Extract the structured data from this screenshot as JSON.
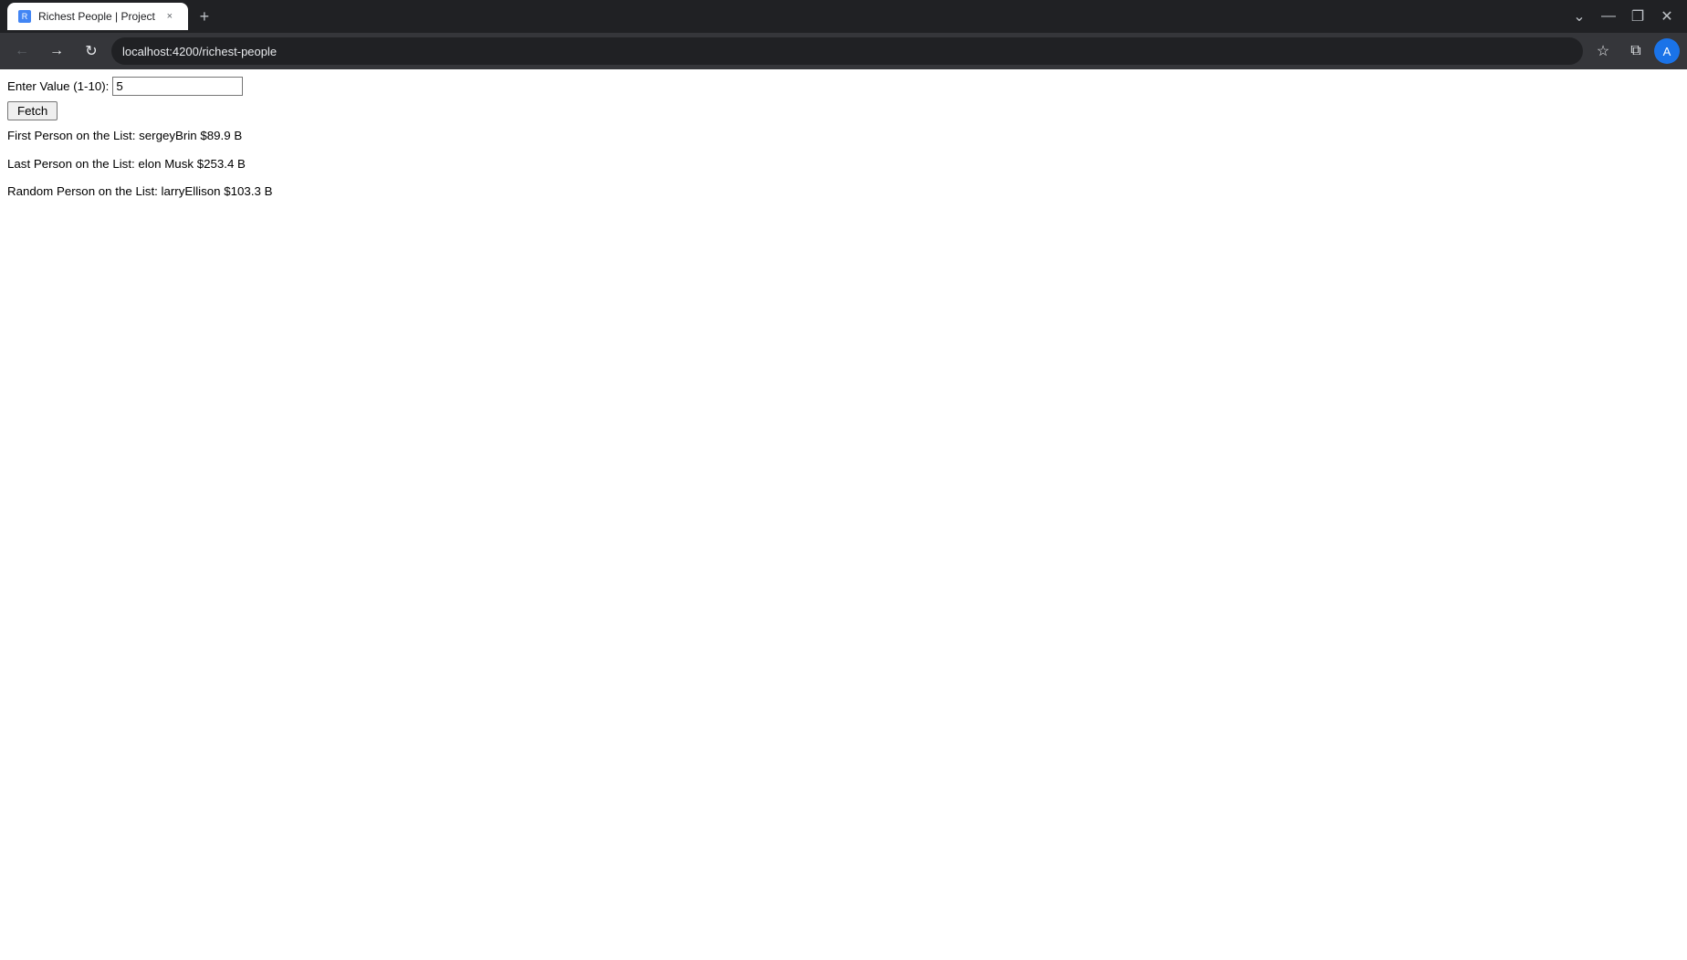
{
  "browser": {
    "tab": {
      "title": "Richest People | Project",
      "favicon_text": "R",
      "close_label": "×"
    },
    "new_tab_label": "+",
    "tab_bar_controls": {
      "minimize": "—",
      "restore": "❐",
      "close": "✕",
      "dropdown": "⌄"
    },
    "toolbar": {
      "back_icon": "←",
      "forward_icon": "→",
      "reload_icon": "↻",
      "url": "localhost:4200/richest-people",
      "bookmark_icon": "☆",
      "extensions_icon": "⧉",
      "profile_icon": "A"
    }
  },
  "page": {
    "label": "Enter Value (1-10):",
    "input_value": "5",
    "fetch_button": "Fetch",
    "results": {
      "first": "First Person on the List: sergeyBrin $89.9 B",
      "last": "Last Person on the List: elon Musk $253.4 B",
      "random": "Random Person on the List: larryEllison $103.3 B"
    }
  }
}
